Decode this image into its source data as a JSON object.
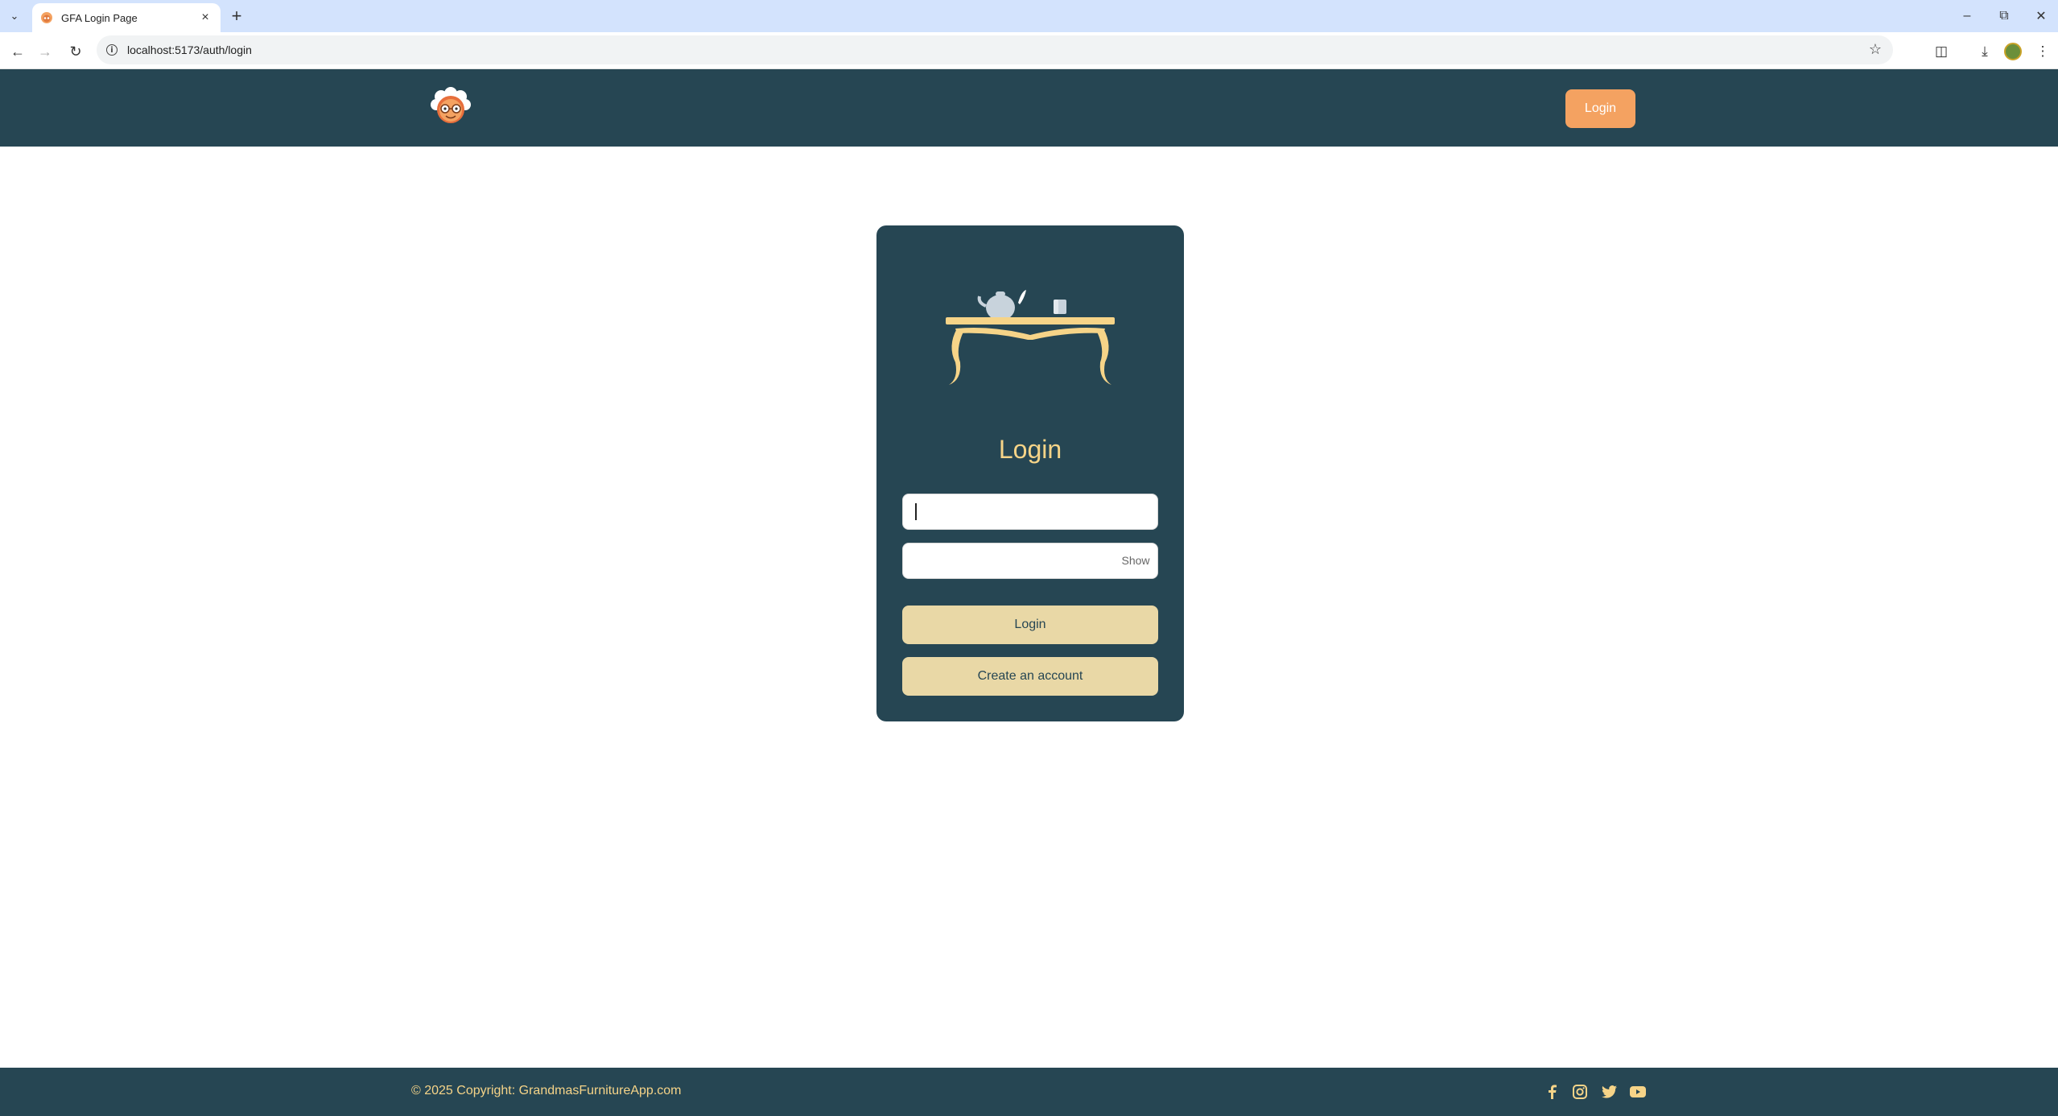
{
  "browser": {
    "tab_title": "GFA Login Page",
    "url": "localhost:5173/auth/login"
  },
  "header": {
    "login_label": "Login"
  },
  "login_card": {
    "title": "Login",
    "username_value": "",
    "password_value": "",
    "show_label": "Show",
    "login_button": "Login",
    "create_account_button": "Create an account"
  },
  "footer": {
    "copyright": "© 2025 Copyright: GrandmasFurnitureApp.com",
    "social_icons": [
      "facebook-icon",
      "instagram-icon",
      "twitter-icon",
      "youtube-icon"
    ]
  },
  "colors": {
    "brand_dark": "#264653",
    "accent_orange": "#f4a261",
    "button_cream": "#e9d8a6",
    "title_gold": "#f6d488",
    "browser_tabstrip": "#d3e3fd"
  }
}
